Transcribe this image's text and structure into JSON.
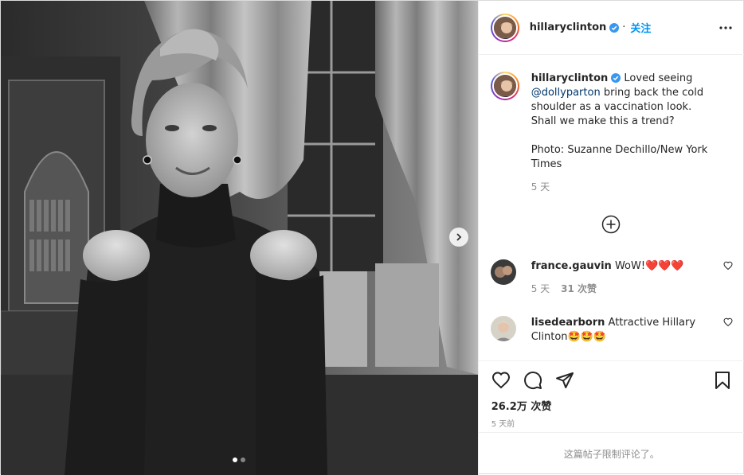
{
  "post": {
    "author": "hillaryclinton",
    "follow_label": "关注",
    "follow_separator": "·",
    "caption_parts": {
      "text_before": "Loved seeing ",
      "mention": "@dollyparton",
      "text_after": " bring back the cold shoulder as a vaccination look. Shall we make this a trend?",
      "credit": "Photo: Suzanne Dechillo/New York Times"
    },
    "caption_age": "5 天",
    "likes": "26.2万 次赞",
    "date": "5 天前",
    "comments_limited": "这篇帖子限制评论了。"
  },
  "comments": [
    {
      "username": "france.gauvin",
      "text": "WoW!❤️❤️❤️",
      "age": "5 天",
      "likes": "31 次赞"
    },
    {
      "username": "lisedearborn",
      "text": "Attractive Hillary Clinton🤩🤩🤩"
    }
  ],
  "carousel": {
    "slides": 2,
    "active_index": 0
  },
  "icons": {
    "verified": "verified-badge-icon",
    "more": "more-options-icon",
    "like": "heart-icon",
    "comment": "comment-icon",
    "share": "paper-plane-icon",
    "save": "bookmark-icon",
    "load_more": "plus-circle-icon",
    "next": "chevron-right-icon"
  },
  "colors": {
    "accent": "#0095f6",
    "verified": "#3897f0",
    "muted": "#8e8e8e",
    "heart": "#ed4956"
  }
}
